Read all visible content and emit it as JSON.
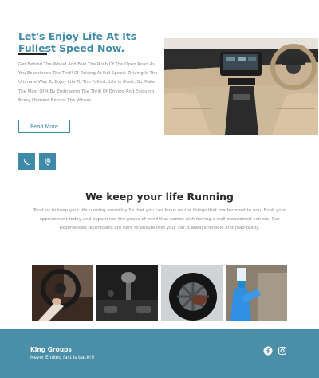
{
  "hero": {
    "title": "Let's Enjoy Life At Its Fullest Speed Now.",
    "body": "Get Behind The Wheel And Feel The Rush Of The Open Road As You Experience The Thrill Of Driving At Full Speed. Driving Is The Ultimate Way To Enjoy Life To The Fullest. Life is Short, So Make The Most Of It By Embracing The Thrill Of Driving And Enjoying Every Moment Behind The Wheel.",
    "read_more_label": "Read More",
    "image": "car-interior-dashboard"
  },
  "contact_icons": [
    "phone-icon",
    "location-pin-icon"
  ],
  "running": {
    "title": "We keep your life Running",
    "body": "Trust us to keep your life running smoothly So that you can focus on the things that matter most to you. Book your appointment today and experience the peace of mind that comes with having a well-maintained vehicle. Our experienced technicians are here to ensure that your car is always reliable and road-ready."
  },
  "gallery": [
    "driver-hands-on-wheel",
    "gear-shifter",
    "tire-wheel-cleaning",
    "interior-cleaning-spray"
  ],
  "footer": {
    "brand": "King Groups",
    "tagline": "Never Ending fast is back!!!",
    "social": [
      "facebook-icon",
      "instagram-icon"
    ]
  },
  "colors": {
    "accent": "#3e8aa8",
    "footer_bg": "#4a8ea8",
    "heading": "#2b2b2b",
    "body_text": "#8b8b8b"
  }
}
